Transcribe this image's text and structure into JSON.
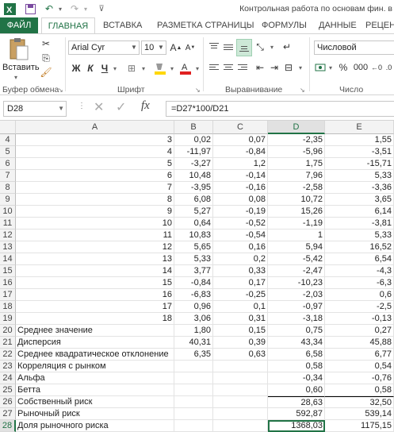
{
  "titlebar": {
    "title": "Контрольная работа по основам фин. в"
  },
  "tabs": [
    "ФАЙЛ",
    "ГЛАВНАЯ",
    "ВСТАВКА",
    "РАЗМЕТКА СТРАНИЦЫ",
    "ФОРМУЛЫ",
    "ДАННЫЕ",
    "РЕЦЕН"
  ],
  "ribbon": {
    "paste_label": "Вставить",
    "clipboard_group": "Буфер обмена",
    "font_group": "Шрифт",
    "alignment_group": "Выравнивание",
    "number_group": "Число",
    "font_name": "Arial Cyr",
    "font_size": "10",
    "bold": "Ж",
    "italic": "К",
    "underline": "Ч",
    "number_format": "Числовой",
    "percent": "%",
    "thousands": "000"
  },
  "formula_bar": {
    "name_box": "D28",
    "formula": "=D27*100/D21"
  },
  "columns": [
    "A",
    "B",
    "C",
    "D",
    "E"
  ],
  "rows": [
    {
      "n": "4",
      "a": "3",
      "b": "0,02",
      "c": "0,07",
      "d": "-2,35",
      "e": "1,55"
    },
    {
      "n": "5",
      "a": "4",
      "b": "-11,97",
      "c": "-0,84",
      "d": "-5,96",
      "e": "-3,51"
    },
    {
      "n": "6",
      "a": "5",
      "b": "-3,27",
      "c": "1,2",
      "d": "1,75",
      "e": "-15,71"
    },
    {
      "n": "7",
      "a": "6",
      "b": "10,48",
      "c": "-0,14",
      "d": "7,96",
      "e": "5,33"
    },
    {
      "n": "8",
      "a": "7",
      "b": "-3,95",
      "c": "-0,16",
      "d": "-2,58",
      "e": "-3,36"
    },
    {
      "n": "9",
      "a": "8",
      "b": "6,08",
      "c": "0,08",
      "d": "10,72",
      "e": "3,65"
    },
    {
      "n": "10",
      "a": "9",
      "b": "5,27",
      "c": "-0,19",
      "d": "15,26",
      "e": "6,14"
    },
    {
      "n": "11",
      "a": "10",
      "b": "0,64",
      "c": "-0,52",
      "d": "-1,19",
      "e": "-3,81"
    },
    {
      "n": "12",
      "a": "11",
      "b": "10,83",
      "c": "-0,54",
      "d": "1",
      "e": "5,33"
    },
    {
      "n": "13",
      "a": "12",
      "b": "5,65",
      "c": "0,16",
      "d": "5,94",
      "e": "16,52"
    },
    {
      "n": "14",
      "a": "13",
      "b": "5,33",
      "c": "0,2",
      "d": "-5,42",
      "e": "6,54"
    },
    {
      "n": "15",
      "a": "14",
      "b": "3,77",
      "c": "0,33",
      "d": "-2,47",
      "e": "-4,3"
    },
    {
      "n": "16",
      "a": "15",
      "b": "-0,84",
      "c": "0,17",
      "d": "-10,23",
      "e": "-6,3"
    },
    {
      "n": "17",
      "a": "16",
      "b": "-6,83",
      "c": "-0,25",
      "d": "-2,03",
      "e": "0,6"
    },
    {
      "n": "18",
      "a": "17",
      "b": "0,96",
      "c": "0,1",
      "d": "-0,97",
      "e": "-2,5"
    },
    {
      "n": "19",
      "a": "18",
      "b": "3,06",
      "c": "0,31",
      "d": "-3,18",
      "e": "-0,13"
    },
    {
      "n": "20",
      "a": "Среднее значение",
      "b": "1,80",
      "c": "0,15",
      "d": "0,75",
      "e": "0,27"
    },
    {
      "n": "21",
      "a": "Дисперсия",
      "b": "40,31",
      "c": "0,39",
      "d": "43,34",
      "e": "45,88"
    },
    {
      "n": "22",
      "a": "Среднее квадратическое отклонение",
      "b": "6,35",
      "c": "0,63",
      "d": "6,58",
      "e": "6,77"
    },
    {
      "n": "23",
      "a": "Корреляция с рынком",
      "b": "",
      "c": "",
      "d": "0,58",
      "e": "0,54"
    },
    {
      "n": "24",
      "a": "Альфа",
      "b": "",
      "c": "",
      "d": "-0,34",
      "e": "-0,76"
    },
    {
      "n": "25",
      "a": "Бетта",
      "b": "",
      "c": "",
      "d": "0,60",
      "e": "0,58"
    },
    {
      "n": "26",
      "a": "Собственный риск",
      "b": "",
      "c": "",
      "d": "28,63",
      "e": "32,50"
    },
    {
      "n": "27",
      "a": "Рыночный риск",
      "b": "",
      "c": "",
      "d": "592,87",
      "e": "539,14"
    },
    {
      "n": "28",
      "a": "Доля рыночного риска",
      "b": "",
      "c": "",
      "d": "1368,03",
      "e": "1175,15"
    }
  ]
}
